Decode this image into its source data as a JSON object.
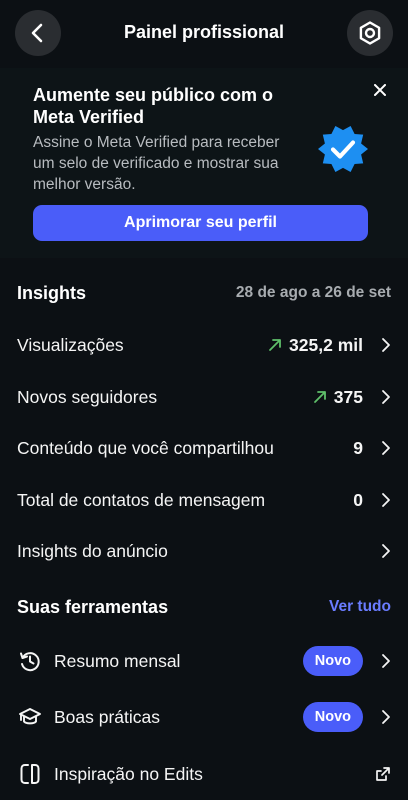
{
  "header": {
    "title": "Painel profissional",
    "back_icon": "chevron-left-icon",
    "settings_icon": "gear-icon"
  },
  "banner": {
    "title": "Aumente seu público com o Meta Verified",
    "text": "Assine o Meta Verified para receber um selo de verificado e mostrar sua melhor versão.",
    "button": "Aprimorar seu perfil",
    "badge_icon": "verified-badge-icon",
    "close_icon": "close-icon"
  },
  "insights": {
    "title": "Insights",
    "range": "28 de ago a 26 de set",
    "rows": [
      {
        "label": "Visualizações",
        "value": "325,2 mil",
        "trend": "up"
      },
      {
        "label": "Novos seguidores",
        "value": "375",
        "trend": "up"
      },
      {
        "label": "Conteúdo que você compartilhou",
        "value": "9"
      },
      {
        "label": "Total de contatos de mensagem",
        "value": "0"
      },
      {
        "label": "Insights do anúncio",
        "value": ""
      }
    ]
  },
  "tools": {
    "title": "Suas ferramentas",
    "see_all": "Ver tudo",
    "items": [
      {
        "label": "Resumo mensal",
        "badge": "Novo",
        "icon": "history-icon"
      },
      {
        "label": "Boas práticas",
        "badge": "Novo",
        "icon": "graduation-cap-icon"
      },
      {
        "label": "Inspiração no Edits",
        "icon": "edits-icon"
      }
    ]
  },
  "colors": {
    "background": "#0c1014",
    "accent": "#4a5df9",
    "link": "#6a7cff",
    "trend_up": "#5fbf6a",
    "badge_blue": "#1d8ff2"
  }
}
